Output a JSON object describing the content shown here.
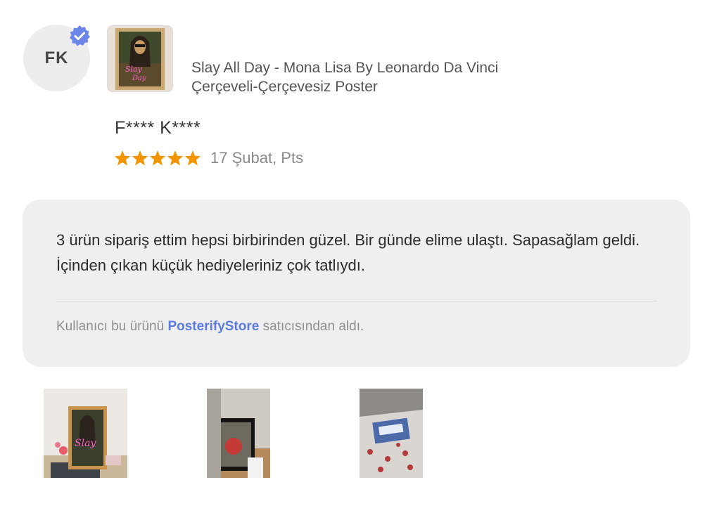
{
  "reviewer": {
    "initials": "FK",
    "name": "F**** K****",
    "verified": true
  },
  "product": {
    "title_line1": "Slay All Day - Mona Lisa By Leonardo Da Vinci",
    "title_line2": "Çerçeveli-Çerçevesiz Poster"
  },
  "rating": {
    "stars": 5,
    "max": 5,
    "date": "17 Şubat, Pts",
    "star_color": "#f39400"
  },
  "review": {
    "text": "3 ürün sipariş ettim hepsi birbirinden güzel. Bir günde elime ulaştı. Sapasağlam geldi. İçinden çıkan küçük hediyeleriniz çok tatlıydı.",
    "seller_prefix": "Kullanıcı bu ürünü ",
    "seller_name": "PosterifyStore",
    "seller_suffix": " satıcısından aldı."
  },
  "colors": {
    "accent": "#5c7cdd",
    "verified_badge": "#6b86e8",
    "bubble_bg": "#efefef"
  },
  "photos": [
    "photo-1",
    "photo-2",
    "photo-3"
  ]
}
